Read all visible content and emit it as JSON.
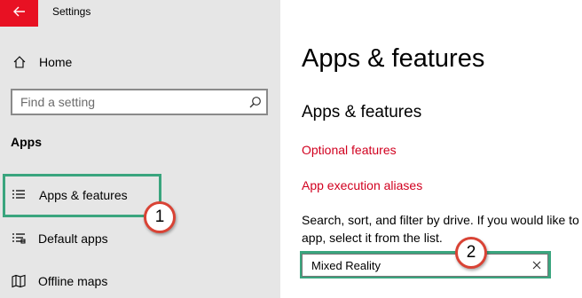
{
  "window": {
    "title": "Settings",
    "back_icon": "arrow-left-icon",
    "accent": "#e81123"
  },
  "sidebar": {
    "home_label": "Home",
    "home_icon": "home-icon",
    "search": {
      "placeholder": "Find a setting",
      "value": "",
      "icon": "search-icon"
    },
    "section_label": "Apps",
    "items": [
      {
        "label": "Apps & features",
        "icon": "list-icon"
      },
      {
        "label": "Default apps",
        "icon": "default-apps-icon"
      },
      {
        "label": "Offline maps",
        "icon": "map-icon"
      }
    ]
  },
  "main": {
    "page_title": "Apps & features",
    "section_title": "Apps & features",
    "links": [
      "Optional features",
      "App execution aliases"
    ],
    "description": [
      "Search, sort, and filter by drive. If you would like to",
      "app, select it from the list."
    ],
    "filter": {
      "value": "Mixed Reality",
      "clear_icon": "close-icon"
    },
    "link_color": "#d1001f"
  },
  "annotations": {
    "callout_1": "1",
    "callout_2": "2",
    "highlight_color": "#3aa57e",
    "callout_color": "#d94335"
  }
}
